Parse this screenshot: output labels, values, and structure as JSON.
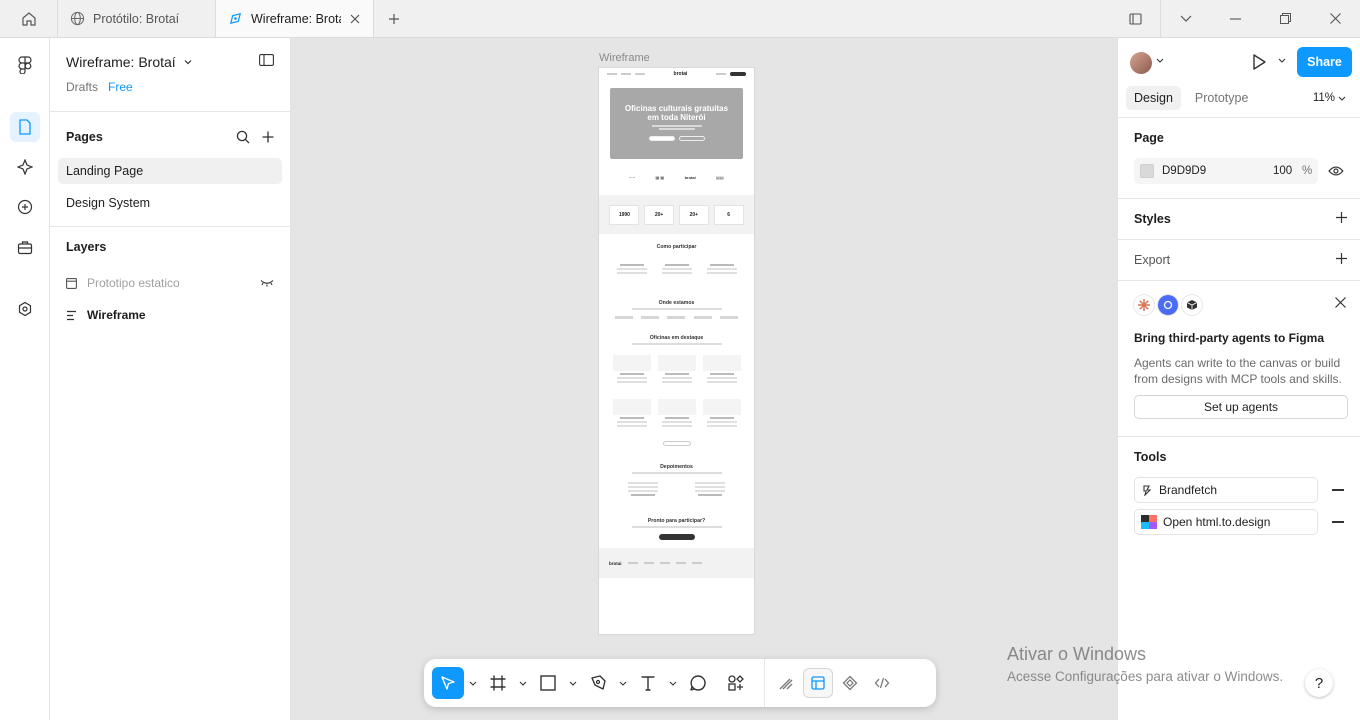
{
  "tabs": [
    {
      "label": "Protótilo: Brotaí",
      "icon": "globe-icon",
      "active": false
    },
    {
      "label": "Wireframe: Brotaí",
      "icon": "figma-file-icon",
      "active": true
    }
  ],
  "file": {
    "title": "Wireframe: Brotaí",
    "location": "Drafts",
    "plan": "Free"
  },
  "pages": {
    "title": "Pages",
    "items": [
      "Landing Page",
      "Design System"
    ]
  },
  "layers": {
    "title": "Layers",
    "items": [
      {
        "label": "Prototipo estatico",
        "icon": "frame-icon",
        "hidden": true
      },
      {
        "label": "Wireframe",
        "icon": "layout-icon",
        "hidden": false
      }
    ]
  },
  "canvas": {
    "frame_label": "Wireframe",
    "wireframe": {
      "brand": "brotai",
      "hero_title": "Oficinas culturais gratuitas em toda Niterói",
      "stats": [
        "1990",
        "20+",
        "20+",
        "6"
      ],
      "how_title": "Como participar",
      "where_title": "Onde estamos",
      "featured_title": "Oficinas em destaque",
      "testimonials_title": "Depoimentos",
      "cta_title": "Pronto para participar?"
    }
  },
  "toolbar": {
    "tools": [
      "move-icon",
      "frame-tool-icon",
      "rectangle-icon",
      "pen-icon",
      "text-icon",
      "comment-icon",
      "actions-icon"
    ],
    "modes": [
      "draw-mode-icon",
      "design-mode-icon",
      "dev-mode-icon",
      "code-icon"
    ]
  },
  "right": {
    "share": "Share",
    "tabs": [
      "Design",
      "Prototype"
    ],
    "zoom": "11%",
    "page": {
      "title": "Page",
      "fill_hex": "D9D9D9",
      "opacity": "100",
      "unit": "%"
    },
    "styles": "Styles",
    "export": "Export",
    "agents": {
      "title": "Bring third-party agents to Figma",
      "description": "Agents can write to the canvas or build from designs with MCP tools and skills.",
      "button": "Set up agents"
    },
    "tools": {
      "title": "Tools",
      "items": [
        "Brandfetch",
        "Open html.to.design"
      ]
    }
  },
  "watermark": {
    "title": "Ativar o Windows",
    "subtitle": "Acesse Configurações para ativar o Windows."
  },
  "help": "?",
  "colors": {
    "accent": "#0d99ff",
    "canvas": "#e5e5e5"
  }
}
